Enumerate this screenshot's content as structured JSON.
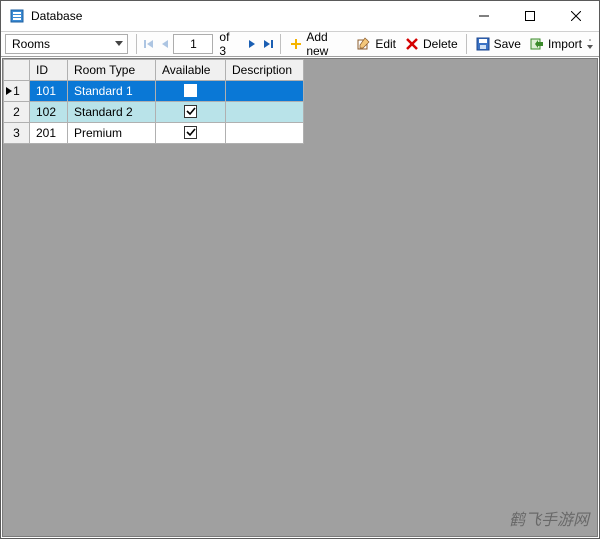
{
  "window": {
    "title": "Database"
  },
  "toolbar": {
    "table_selector": {
      "value": "Rooms"
    },
    "nav": {
      "page_value": "1",
      "of_label": "of 3"
    },
    "addnew_label": "Add new",
    "edit_label": "Edit",
    "delete_label": "Delete",
    "save_label": "Save",
    "import_label": "Import"
  },
  "grid": {
    "headers": {
      "id": "ID",
      "room_type": "Room Type",
      "available": "Available",
      "description": "Description"
    },
    "rows": [
      {
        "n": "1",
        "id": "101",
        "type": "Standard 1",
        "available": true,
        "desc": "",
        "selected": true
      },
      {
        "n": "2",
        "id": "102",
        "type": "Standard 2",
        "available": true,
        "desc": "",
        "alt": true
      },
      {
        "n": "3",
        "id": "201",
        "type": "Premium",
        "available": true,
        "desc": ""
      }
    ]
  },
  "watermark": "鹤飞手游网"
}
